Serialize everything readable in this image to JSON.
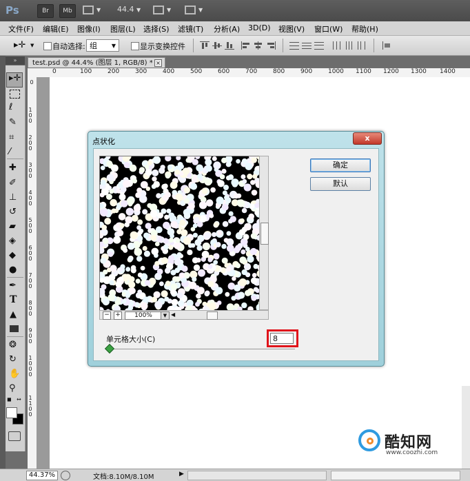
{
  "app": {
    "logo": "Ps",
    "bridge_btn": "Br",
    "minibridge_btn": "Mb",
    "zoom": "44.4"
  },
  "menu": [
    "文件(F)",
    "编辑(E)",
    "图像(I)",
    "图层(L)",
    "选择(S)",
    "滤镜(T)",
    "分析(A)",
    "3D(D)",
    "视图(V)",
    "窗口(W)",
    "帮助(H)"
  ],
  "options": {
    "auto_select_label": "自动选择:",
    "auto_select_value": "组",
    "show_transform_label": "显示变换控件"
  },
  "document": {
    "tab_title": "test.psd @ 44.4% (图层 1, RGB/8) *",
    "close_glyph": "×"
  },
  "ruler": {
    "top_labels": [
      "0",
      "100",
      "200",
      "300",
      "400",
      "500",
      "600",
      "700",
      "800",
      "900",
      "1000",
      "1100",
      "1200",
      "1300",
      "1400"
    ],
    "left_labels": [
      "0",
      "1 0 0",
      "2 0 0",
      "3 0 0",
      "4 0 0",
      "5 0 0",
      "6 0 0",
      "7 0 0",
      "8 0 0",
      "9 0 0",
      "1 0 0 0",
      "1 1 0 0"
    ]
  },
  "status": {
    "zoom": "44.37%",
    "doc_info": "文档:8.10M/8.10M"
  },
  "dialog": {
    "title": "点状化",
    "close_glyph": "x",
    "ok_label": "确定",
    "reset_label": "默认",
    "preview_zoom": "100%",
    "zoom_out": "−",
    "zoom_in": "+",
    "cell_size_label": "单元格大小(C)",
    "cell_size_value": "8"
  },
  "watermark": {
    "brand": "酷知网",
    "url": "www.coozhi.com"
  }
}
